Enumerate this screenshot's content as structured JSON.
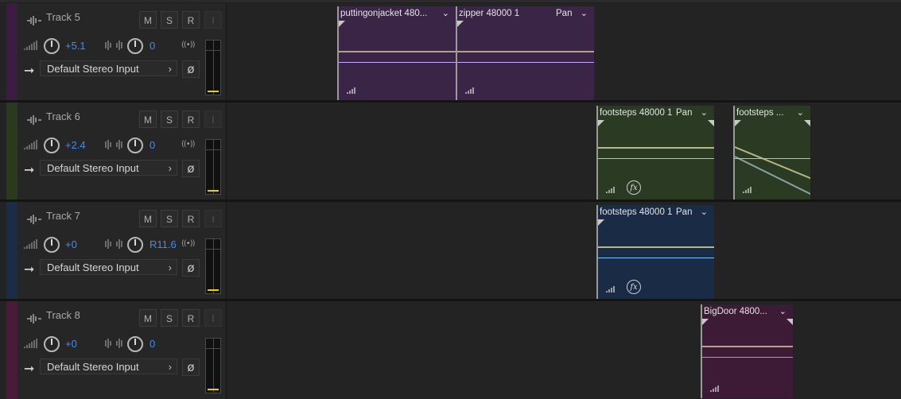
{
  "tracks": [
    {
      "name": "Track 5",
      "color": "#3b1e3f",
      "buttons": {
        "mute": "M",
        "solo": "S",
        "record": "R",
        "input_monitor": "I"
      },
      "volume": "+5.1",
      "pan": "0",
      "input": "Default Stereo Input",
      "clips": [
        {
          "title": "puttingonjacket 480...",
          "bg": "#3a2546",
          "wave": "#c9a8ff"
        },
        {
          "title": "zipper 48000 1",
          "pan_label": "Pan",
          "bg": "#3a2546",
          "wave": "#c9a8ff"
        }
      ]
    },
    {
      "name": "Track 6",
      "color": "#2b3a1f",
      "buttons": {
        "mute": "M",
        "solo": "S",
        "record": "R",
        "input_monitor": "I"
      },
      "volume": "+2.4",
      "pan": "0",
      "input": "Default Stereo Input",
      "clips": [
        {
          "title": "footsteps 48000 1",
          "pan_label": "Pan",
          "bg": "#2b3a22",
          "wave": "#9be05a"
        },
        {
          "title": "footsteps ...",
          "bg": "#2b3a22",
          "wave": "#9be05a"
        }
      ]
    },
    {
      "name": "Track 7",
      "color": "#1b2c44",
      "buttons": {
        "mute": "M",
        "solo": "S",
        "record": "R",
        "input_monitor": "I"
      },
      "volume": "+0",
      "pan": "R11.6",
      "input": "Default Stereo Input",
      "clips": [
        {
          "title": "footsteps 48000 1",
          "pan_label": "Pan",
          "bg": "#192b45",
          "wave": "#7fc3ff"
        }
      ]
    },
    {
      "name": "Track 8",
      "color": "#4a1a3a",
      "buttons": {
        "mute": "M",
        "solo": "S",
        "record": "R",
        "input_monitor": "I"
      },
      "volume": "+0",
      "pan": "0",
      "input": "Default Stereo Input",
      "clips": [
        {
          "title": "BigDoor 4800...",
          "bg": "#3d1a36",
          "wave": "#ff6fc4"
        }
      ]
    }
  ],
  "icons": {
    "track_type": "waveform-icon",
    "volume": "volume-knob-icon",
    "pan": "pan-knob-icon",
    "stereo": "stereo-icon",
    "input_arrow": "input-arrow-icon",
    "phase": "phase-invert-icon",
    "chevron": "chevron-down-icon",
    "fx": "fx-icon"
  },
  "glyphs": {
    "stereo": "((•))",
    "arrow": "➞",
    "chevron_right": "›",
    "chevron_down": "⌄",
    "phase": "ø",
    "fx": "fx"
  }
}
